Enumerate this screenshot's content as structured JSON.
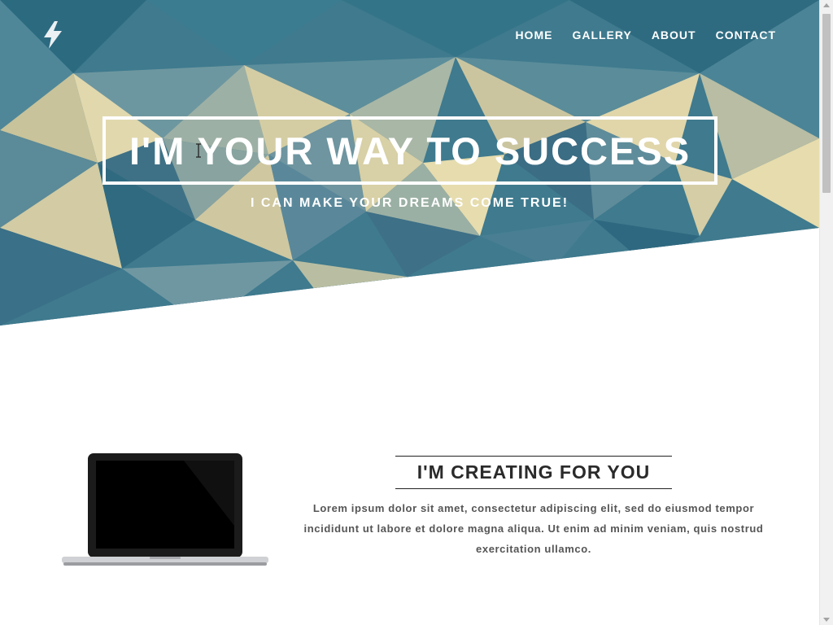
{
  "nav": {
    "items": [
      {
        "label": "HOME"
      },
      {
        "label": "GALLERY"
      },
      {
        "label": "ABOUT"
      },
      {
        "label": "CONTACT"
      }
    ]
  },
  "hero": {
    "headline": "I'M YOUR WAY TO SUCCESS",
    "subheadline": "I CAN MAKE YOUR DREAMS COME TRUE!"
  },
  "section": {
    "title": "I'M CREATING FOR YOU",
    "body": "Lorem ipsum dolor sit amet, consectetur adipiscing elit, sed do eiusmod tempor incididunt ut labore et dolore magna aliqua. Ut enim ad minim veniam, quis nostrud exercitation ullamco."
  },
  "icons": {
    "logo": "lightning-bolt-icon",
    "laptop": "laptop-image"
  },
  "colors": {
    "hero_primary": "#2f6f85",
    "hero_accent": "#c9c6a0",
    "text_light": "#ffffff",
    "text_dark": "#2a2a2a",
    "text_body": "#555555"
  }
}
